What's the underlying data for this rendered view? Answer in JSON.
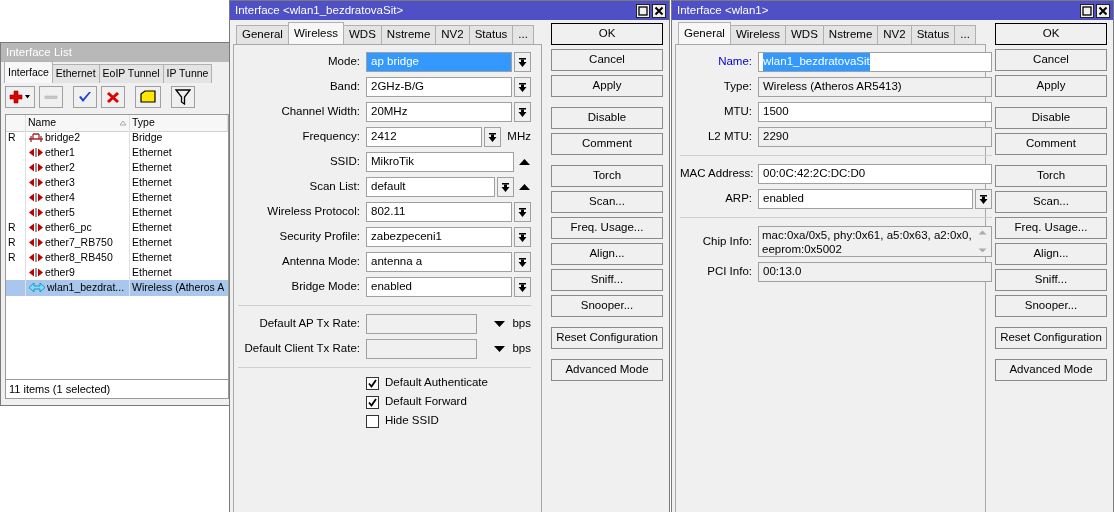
{
  "interface_list": {
    "title": "Interface List",
    "active": false,
    "tabs": [
      {
        "label": "Interface",
        "selected": true
      },
      {
        "label": "Ethernet",
        "selected": false
      },
      {
        "label": "EoIP Tunnel",
        "selected": false
      },
      {
        "label": "IP Tunne",
        "selected": false
      }
    ],
    "columns": [
      "Name",
      "Type"
    ],
    "rows": [
      {
        "flag": "R",
        "name": "bridge2",
        "type": "Bridge",
        "kind": "bridge",
        "selected": false
      },
      {
        "name": "ether1",
        "type": "Ethernet",
        "kind": "ethernet",
        "selected": false
      },
      {
        "name": "ether2",
        "type": "Ethernet",
        "kind": "ethernet",
        "selected": false
      },
      {
        "name": "ether3",
        "type": "Ethernet",
        "kind": "ethernet",
        "selected": false
      },
      {
        "name": "ether4",
        "type": "Ethernet",
        "kind": "ethernet",
        "selected": false
      },
      {
        "name": "ether5",
        "type": "Ethernet",
        "kind": "ethernet",
        "selected": false
      },
      {
        "flag": "R",
        "name": "ether6_pc",
        "type": "Ethernet",
        "kind": "ethernet",
        "selected": false
      },
      {
        "flag": "R",
        "name": "ether7_RB750",
        "type": "Ethernet",
        "kind": "ethernet",
        "selected": false
      },
      {
        "flag": "R",
        "name": "ether8_RB450",
        "type": "Ethernet",
        "kind": "ethernet",
        "selected": false
      },
      {
        "name": "ether9",
        "type": "Ethernet",
        "kind": "ethernet",
        "selected": false
      },
      {
        "name": "wlan1_bezdrat...",
        "type": "Wireless (Atheros A",
        "kind": "wireless",
        "selected": true
      }
    ],
    "status": "11 items (1 selected)"
  },
  "dialogs": [
    {
      "title": "Interface <wlan1_bezdratovaSit>",
      "active": true,
      "tabs": [
        {
          "label": "General",
          "selected": false
        },
        {
          "label": "Wireless",
          "selected": true
        },
        {
          "label": "WDS",
          "selected": false
        },
        {
          "label": "Nstreme",
          "selected": false
        },
        {
          "label": "NV2",
          "selected": false
        },
        {
          "label": "Status",
          "selected": false
        },
        {
          "label": "...",
          "selected": false
        }
      ],
      "fields": [
        {
          "kind": "dropdown",
          "label": "Mode:",
          "value": "ap bridge",
          "highlighted": true
        },
        {
          "kind": "dropdown",
          "label": "Band:",
          "value": "2GHz-B/G",
          "highlighted": false
        },
        {
          "kind": "dropdown",
          "label": "Channel Width:",
          "value": "20MHz",
          "highlighted": false
        },
        {
          "kind": "dropdown",
          "label": "Frequency:",
          "value": "2412",
          "unit": "MHz",
          "highlighted": false
        },
        {
          "kind": "text",
          "label": "SSID:",
          "value": "MikroTik",
          "collapsible": true,
          "highlighted": false
        },
        {
          "kind": "dropdown",
          "label": "Scan List:",
          "value": "default",
          "collapsible": true,
          "highlighted": false
        },
        {
          "kind": "dropdown",
          "label": "Wireless Protocol:",
          "value": "802.11",
          "highlighted": false
        },
        {
          "kind": "dropdown",
          "label": "Security Profile:",
          "value": "zabezpeceni1",
          "highlighted": false
        },
        {
          "kind": "dropdown",
          "label": "Antenna Mode:",
          "value": "antenna a",
          "highlighted": false
        },
        {
          "kind": "dropdown",
          "label": "Bridge Mode:",
          "value": "enabled",
          "highlighted": false
        },
        {
          "kind": "separator"
        },
        {
          "kind": "rate",
          "label": "Default AP Tx Rate:",
          "unit": "bps"
        },
        {
          "kind": "rate",
          "label": "Default Client Tx Rate:",
          "unit": "bps"
        },
        {
          "kind": "separator"
        },
        {
          "kind": "checkbox",
          "label": "Default Authenticate",
          "checked": true
        },
        {
          "kind": "checkbox",
          "label": "Default Forward",
          "checked": true
        },
        {
          "kind": "checkbox",
          "label": "Hide SSID",
          "checked": false
        }
      ],
      "button_groups": [
        [
          {
            "label": "OK",
            "default": true
          },
          {
            "label": "Cancel",
            "default": false
          },
          {
            "label": "Apply",
            "default": false
          }
        ],
        [
          {
            "label": "Disable",
            "default": false
          },
          {
            "label": "Comment",
            "default": false
          }
        ],
        [
          {
            "label": "Torch",
            "default": false
          },
          {
            "label": "Scan...",
            "default": false
          },
          {
            "label": "Freq. Usage...",
            "default": false
          },
          {
            "label": "Align...",
            "default": false
          },
          {
            "label": "Sniff...",
            "default": false
          },
          {
            "label": "Snooper...",
            "default": false
          }
        ],
        [
          {
            "label": "Reset Configuration",
            "default": false
          }
        ],
        [
          {
            "label": "Advanced Mode",
            "default": false
          }
        ]
      ]
    },
    {
      "title": "Interface <wlan1>",
      "active": true,
      "tabs": [
        {
          "label": "General",
          "selected": true
        },
        {
          "label": "Wireless",
          "selected": false
        },
        {
          "label": "WDS",
          "selected": false
        },
        {
          "label": "Nstreme",
          "selected": false
        },
        {
          "label": "NV2",
          "selected": false
        },
        {
          "label": "Status",
          "selected": false
        },
        {
          "label": "...",
          "selected": false
        }
      ],
      "fields": [
        {
          "kind": "text",
          "label": "Name:",
          "value": "wlan1_bezdratovaSit",
          "highlighted": true
        },
        {
          "kind": "readonly",
          "label": "Type:",
          "value": "Wireless (Atheros AR5413)"
        },
        {
          "kind": "text",
          "label": "MTU:",
          "value": "1500",
          "highlighted": false
        },
        {
          "kind": "readonly",
          "label": "L2 MTU:",
          "value": "2290"
        },
        {
          "kind": "separator"
        },
        {
          "kind": "text",
          "label": "MAC Address:",
          "value": "00:0C:42:2C:DC:D0",
          "highlighted": false
        },
        {
          "kind": "dropdown",
          "label": "ARP:",
          "value": "enabled",
          "highlighted": false
        },
        {
          "kind": "separator"
        },
        {
          "kind": "multiline",
          "label": "Chip Info:",
          "lines": [
            "mac:0xa/0x5, phy:0x61, a5:0x63, a2:0x0,",
            "eeprom:0x5002"
          ]
        },
        {
          "kind": "readonly",
          "label": "PCI Info:",
          "value": "00:13.0"
        }
      ],
      "button_groups": [
        [
          {
            "label": "OK",
            "default": true
          },
          {
            "label": "Cancel",
            "default": false
          },
          {
            "label": "Apply",
            "default": false
          }
        ],
        [
          {
            "label": "Disable",
            "default": false
          },
          {
            "label": "Comment",
            "default": false
          }
        ],
        [
          {
            "label": "Torch",
            "default": false
          },
          {
            "label": "Scan...",
            "default": false
          },
          {
            "label": "Freq. Usage...",
            "default": false
          },
          {
            "label": "Align...",
            "default": false
          },
          {
            "label": "Sniff...",
            "default": false
          },
          {
            "label": "Snooper...",
            "default": false
          }
        ],
        [
          {
            "label": "Reset Configuration",
            "default": false
          }
        ],
        [
          {
            "label": "Advanced Mode",
            "default": false
          }
        ]
      ]
    }
  ]
}
